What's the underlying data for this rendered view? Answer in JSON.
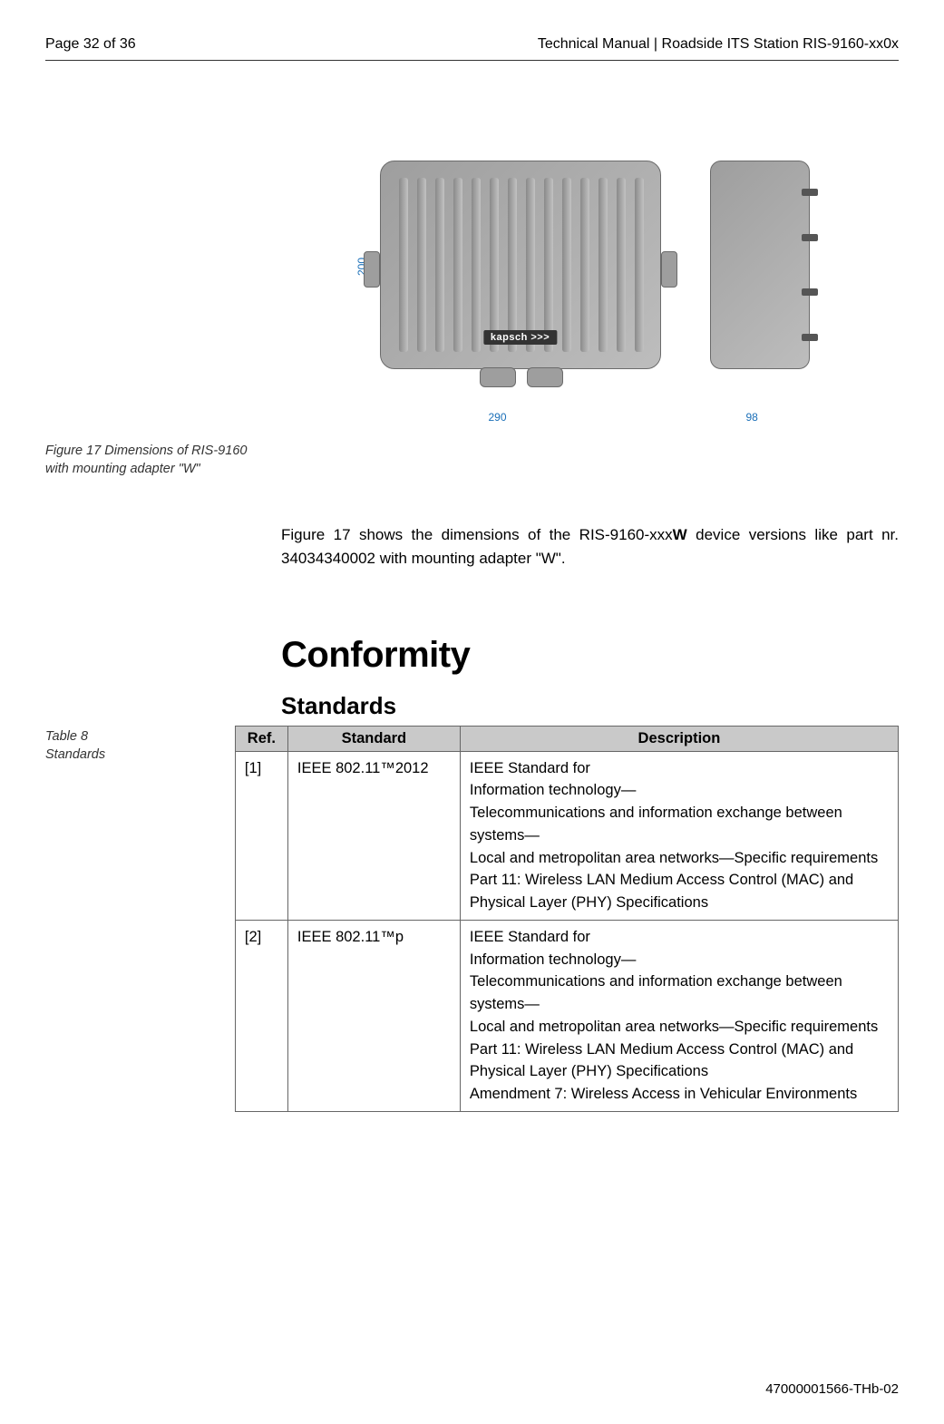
{
  "header": {
    "page_info": "Page 32 of 36",
    "doc_title": "Technical Manual | Roadside ITS Station RIS-9160-xx0x"
  },
  "figure": {
    "caption": "Figure 17 Dimensions of RIS-9160 with mounting adapter \"W\"",
    "dim_height": "200",
    "dim_width": "290",
    "dim_depth": "98",
    "brand": "kapsch >>>"
  },
  "body_text": {
    "prefix": "Figure 17 shows the dimensions of the RIS-9160-xxx",
    "bold": "W",
    "suffix": " device versions like part nr. 34034340002 with mounting adapter \"W\"."
  },
  "h1": "Conformity",
  "h2": "Standards",
  "table": {
    "caption_line1": "Table 8",
    "caption_line2": "Standards",
    "headers": {
      "ref": "Ref.",
      "standard": "Standard",
      "description": "Description"
    },
    "rows": [
      {
        "ref": "[1]",
        "standard": "IEEE 802.11™2012",
        "description": "IEEE Standard for\nInformation technology—\nTelecommunications and information exchange between systems—\nLocal and metropolitan area networks—Specific requirements\nPart 11: Wireless LAN Medium Access Control (MAC) and Physical Layer (PHY) Specifications"
      },
      {
        "ref": "[2]",
        "standard": "IEEE 802.11™p",
        "description": "IEEE Standard for\nInformation technology—\nTelecommunications and information exchange between systems—\nLocal and metropolitan area networks—Specific requirements Part 11: Wireless LAN Medium Access Control (MAC) and Physical Layer (PHY) Specifications\nAmendment 7: Wireless Access in Vehicular Environments"
      }
    ]
  },
  "footer": "47000001566-THb-02"
}
